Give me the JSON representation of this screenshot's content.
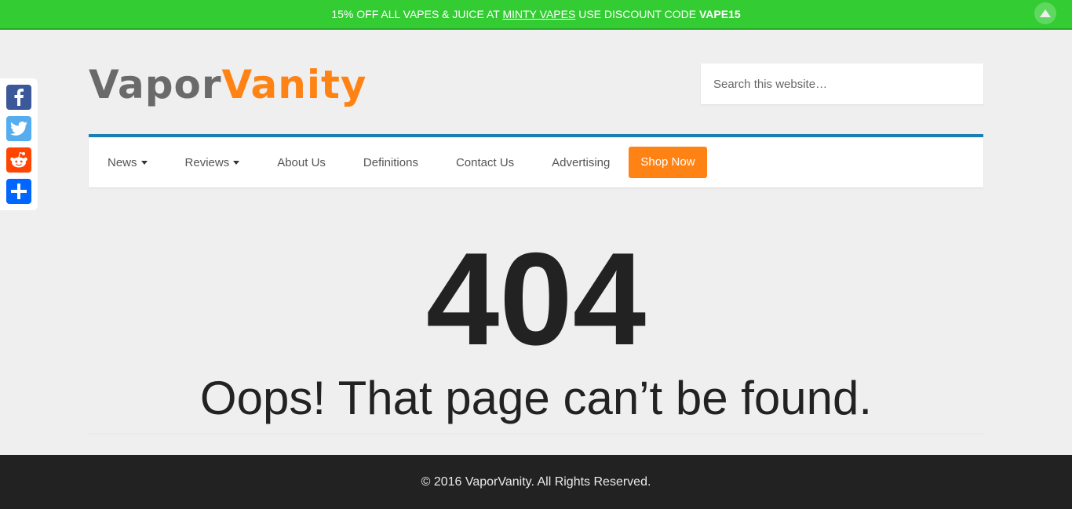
{
  "promo": {
    "prefix": "15% OFF ALL VAPES & JUICE AT ",
    "link": "MINTY VAPES",
    "middle": " USE DISCOUNT CODE ",
    "code": "VAPE15"
  },
  "social": {
    "facebook_icon": "facebook-icon",
    "twitter_icon": "twitter-icon",
    "reddit_icon": "reddit-icon",
    "share_icon": "plus-share-icon"
  },
  "logo": {
    "part1": "Vapor",
    "part2": "Vanity"
  },
  "search": {
    "placeholder": "Search this website…"
  },
  "nav": {
    "news": "News",
    "reviews": "Reviews",
    "about": "About Us",
    "definitions": "Definitions",
    "contact": "Contact Us",
    "advertising": "Advertising",
    "shop": "Shop Now"
  },
  "error": {
    "code": "404",
    "message": "Oops! That page can’t be found."
  },
  "footer": {
    "text": "© 2016 VaporVanity. All Rights Reserved."
  },
  "colors": {
    "promo_green": "#33cc33",
    "brand_orange": "#ff8314",
    "nav_accent": "#1b7fb4",
    "footer_bg": "#222222"
  }
}
